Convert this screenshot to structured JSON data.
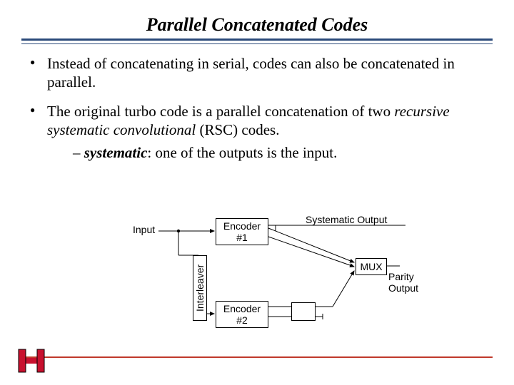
{
  "title": "Parallel Concatenated Codes",
  "bullets": [
    "Instead of concatenating in serial, codes can also be concatenated in parallel.",
    "The original turbo code is a parallel concatenation of two "
  ],
  "bullet2_ital": "recursive systematic convolutional",
  "bullet2_tail": " (RSC) codes.",
  "sub_dash": "– ",
  "sub_bold": "systematic",
  "sub_tail": ": one of the outputs is the input.",
  "diagram": {
    "input": "Input",
    "encoder1": "Encoder\n#1",
    "encoder2": "Encoder\n#2",
    "interleaver": "Interleaver",
    "mux": "MUX",
    "systematic_out": "Systematic Output",
    "parity_out": "Parity\nOutput"
  }
}
